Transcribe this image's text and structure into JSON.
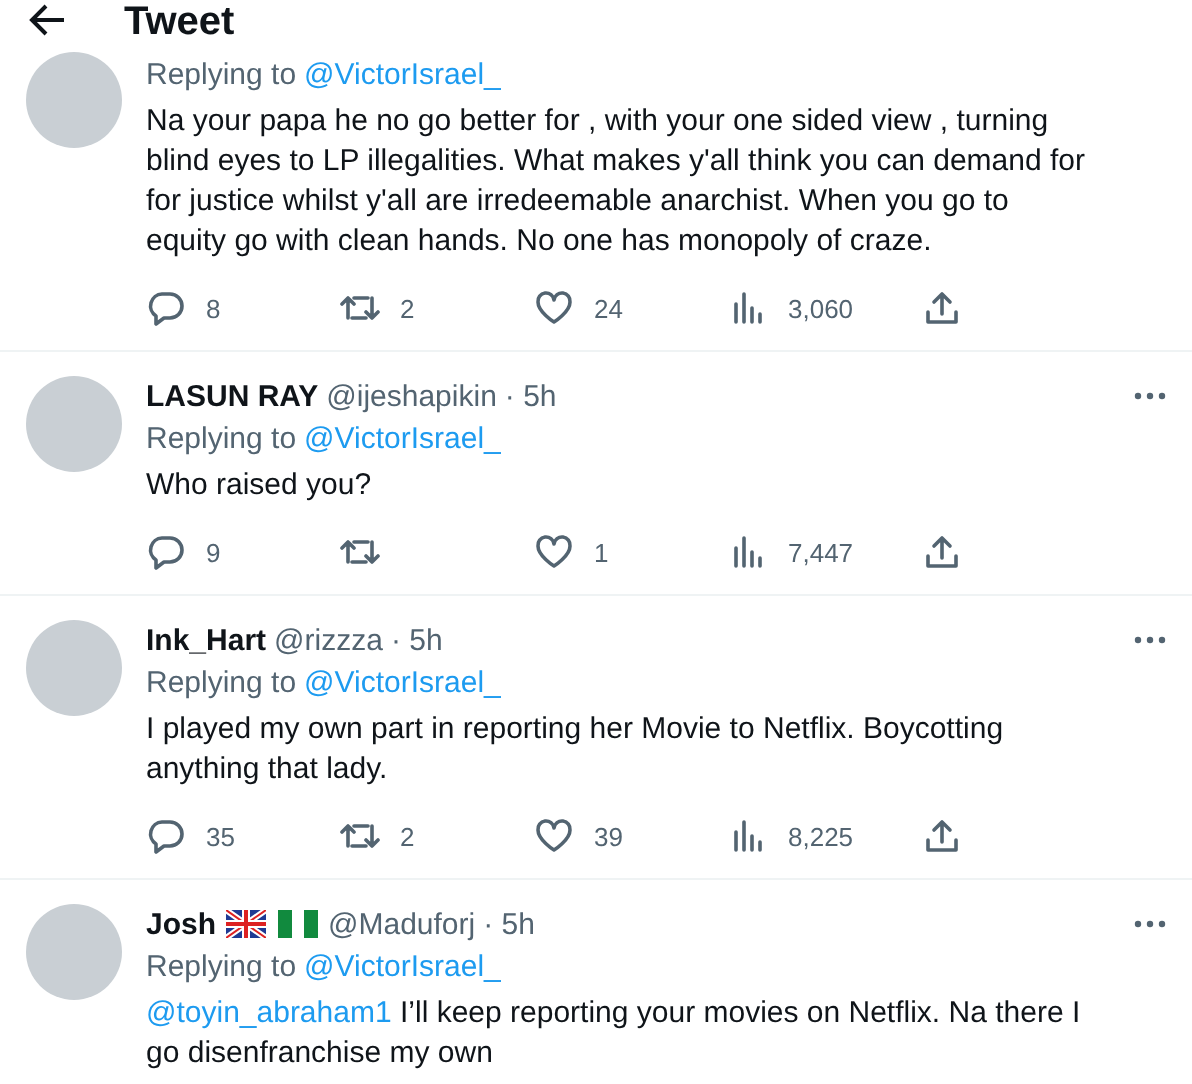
{
  "header": {
    "title": "Tweet"
  },
  "tweets": [
    {
      "reply_to_label": "Replying to",
      "reply_to": "@VictorIsrael_",
      "text": "Na your papa he no go better for , with your one sided view , turning blind eyes to LP illegalities. What makes y'all think you can demand for for justice whilst y'all are irredeemable anarchist.  When you go to equity go with clean hands.  No one has monopoly of craze.",
      "replies": "8",
      "retweets": "2",
      "likes": "24",
      "views": "3,060"
    },
    {
      "name": "LASUN RAY",
      "handle": "@ijeshapikin",
      "time": "· 5h",
      "reply_to_label": "Replying to",
      "reply_to": "@VictorIsrael_",
      "text": "Who raised you?",
      "replies": "9",
      "likes": "1",
      "views": "7,447"
    },
    {
      "name": "Ink_Hart",
      "handle": "@rizzza",
      "time": "· 5h",
      "reply_to_label": "Replying to",
      "reply_to": "@VictorIsrael_",
      "text": "I played my own part in reporting her Movie to Netflix. Boycotting anything that lady.",
      "replies": "35",
      "retweets": "2",
      "likes": "39",
      "views": "8,225"
    },
    {
      "name": "Josh",
      "flags": [
        {
          "kind": "uk"
        },
        {
          "kind": "ng"
        }
      ],
      "handle": "@Maduforj",
      "time": "· 5h",
      "reply_to_label": "Replying to",
      "reply_to": "@VictorIsrael_",
      "mention": "@toyin_abraham1",
      "text": "I’ll keep reporting your movies on Netflix. Na there I go disenfranchise my own"
    }
  ]
}
